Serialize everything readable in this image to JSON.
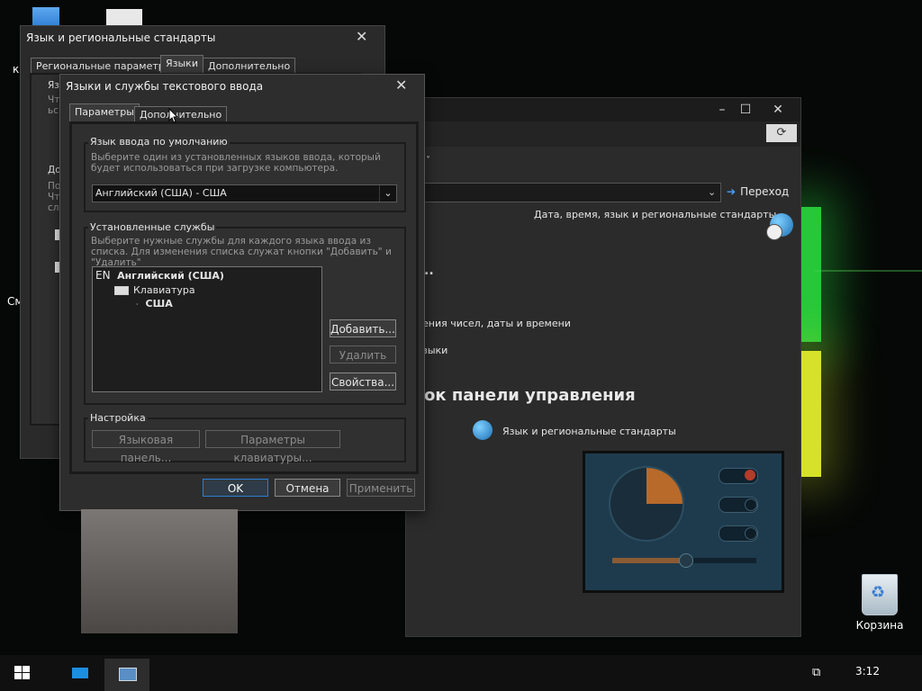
{
  "desktop": {
    "icons": [
      {
        "label": "Корзина"
      }
    ],
    "left_fragments": [
      "к",
      "См"
    ]
  },
  "control_panel": {
    "address_go": "Переход",
    "header_link": "Дата, время, язык и региональные стандарты",
    "dots": "..",
    "link_formats": "ения чисел, даты и времени",
    "link_langs": "зыки",
    "heading": "ок панели управления",
    "result_item": "Язык и региональные стандарты"
  },
  "regional_dialog": {
    "title": "Язык и региональные стандарты",
    "tabs": [
      "Региональные параметры",
      "Языки",
      "Дополнительно"
    ],
    "fragments": [
      "Язь",
      "Чт",
      "ьс",
      "До",
      "По",
      "Чт",
      "сл"
    ]
  },
  "text_services": {
    "title": "Языки и службы текстового ввода",
    "tabs": [
      "Параметры",
      "Дополнительно"
    ],
    "default_input": {
      "label": "Язык ввода по умолчанию",
      "description": "Выберите один из установленных языков ввода, который будет использоваться при загрузке компьютера.",
      "selected": "Английский (США) - США"
    },
    "installed_services": {
      "label": "Установленные службы",
      "description": "Выберите нужные службы для каждого языка ввода из списка. Для изменения списка служат кнопки \"Добавить\" и \"Удалить\"",
      "tree": {
        "lang_code": "EN",
        "language": "Английский (США)",
        "category": "Клавиатура",
        "layout": "США"
      },
      "buttons": {
        "add": "Добавить...",
        "remove": "Удалить",
        "properties": "Свойства..."
      }
    },
    "settings": {
      "label": "Настройка",
      "language_bar": "Языковая панель...",
      "keyboard_settings": "Параметры клавиатуры..."
    },
    "footer": {
      "ok": "OK",
      "cancel": "Отмена",
      "apply": "Применить"
    }
  },
  "taskbar": {
    "time": "3:12"
  }
}
